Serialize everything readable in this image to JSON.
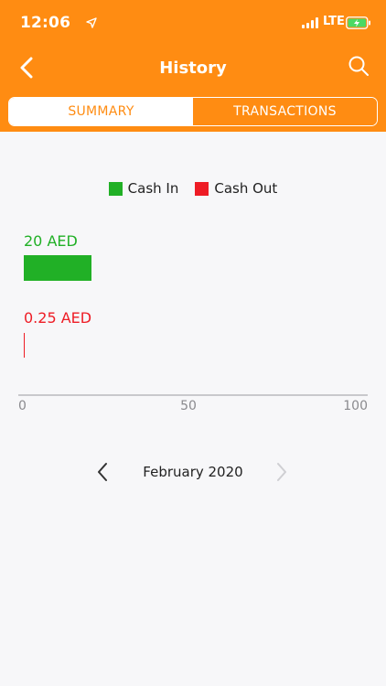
{
  "status_bar": {
    "time": "12:06",
    "network": "LTE"
  },
  "header": {
    "title": "History",
    "back_icon": "chevron-left-icon",
    "search_icon": "search-icon"
  },
  "tabs": [
    {
      "label": "SUMMARY",
      "active": true
    },
    {
      "label": "TRANSACTIONS",
      "active": false
    }
  ],
  "colors": {
    "brand": "#ff8c12",
    "cash_in": "#21b026",
    "cash_out": "#ee1c25"
  },
  "chart_data": {
    "type": "bar",
    "orientation": "horizontal",
    "series": [
      {
        "name": "Cash In",
        "value": 20,
        "label": "20 AED"
      },
      {
        "name": "Cash Out",
        "value": 0.25,
        "label": "0.25 AED"
      }
    ],
    "xlim": [
      0,
      100
    ],
    "x_ticks": [
      "0",
      "50",
      "100"
    ],
    "legend_position": "top-center",
    "grid": false
  },
  "month_nav": {
    "label": "February 2020"
  }
}
